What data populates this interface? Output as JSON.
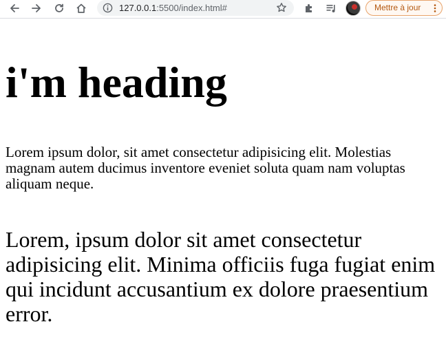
{
  "browser": {
    "url_host": "127.0.0.1",
    "url_rest": ":5500/index.html#",
    "update_button_label": "Mettre à jour",
    "icons": {
      "back": "arrow-left-icon",
      "forward": "arrow-right-icon",
      "reload": "reload-icon",
      "home": "home-icon",
      "site_info": "info-icon",
      "bookmark": "star-icon",
      "extensions": "puzzle-icon",
      "media": "playlist-icon",
      "profile": "avatar",
      "menu": "kebab-menu-icon"
    },
    "colors": {
      "update_accent": "#b3570f",
      "update_border": "#e8a36a",
      "omnibox_bg": "#f1f3f4"
    }
  },
  "page": {
    "heading": "i'm heading",
    "paragraph_1": "Lorem ipsum dolor, sit amet consectetur adipisicing elit. Molestias magnam autem ducimus inventore eveniet soluta quam nam voluptas aliquam neque.",
    "paragraph_2": "Lorem, ipsum dolor sit amet consectetur adipisicing elit. Minima officiis fuga fugiat enim qui incidunt accusantium ex dolore praesentium error."
  }
}
